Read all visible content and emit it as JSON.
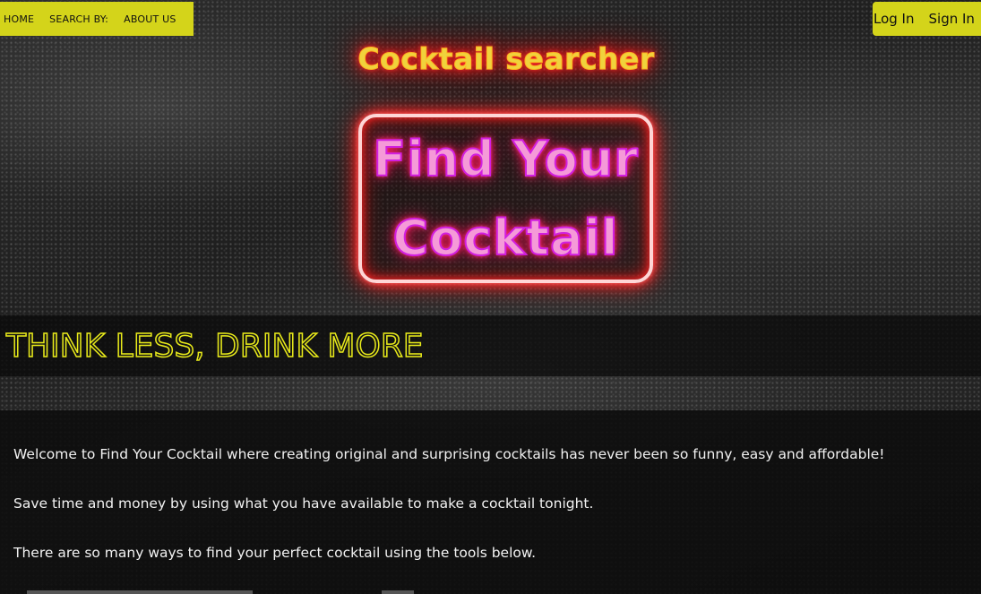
{
  "nav": {
    "home": "HOME",
    "search_by": "SEARCH BY:",
    "about_us": "ABOUT US",
    "log_in": "Log In",
    "sign_in": "Sign In"
  },
  "header": {
    "site_title": "Cocktail searcher"
  },
  "hero": {
    "line1": "Find Your",
    "line2": "Cocktail"
  },
  "tagline": "THINK LESS, DRINK MORE",
  "intro": {
    "paragraphs": [
      "Welcome to Find Your Cocktail where creating original and surprising cocktails has never been so funny, easy and affordable!",
      "Save time and money by using what you have available to make a cocktail tonight.",
      "There are so many ways to find your perfect cocktail using the tools below."
    ]
  },
  "colors": {
    "nav_background": "#d4d41a",
    "title_glow": "#ff2020",
    "neon_text": "#d21fe0",
    "tagline": "#e8ea1a"
  }
}
